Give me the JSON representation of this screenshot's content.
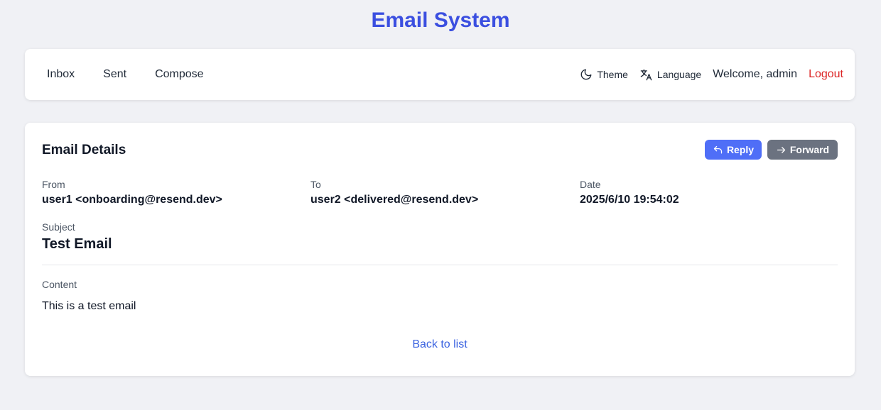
{
  "app": {
    "title": "Email System"
  },
  "nav": {
    "links": [
      "Inbox",
      "Sent",
      "Compose"
    ],
    "theme_label": "Theme",
    "language_label": "Language",
    "welcome": "Welcome, admin",
    "logout": "Logout"
  },
  "email": {
    "heading": "Email Details",
    "reply_label": "Reply",
    "forward_label": "Forward",
    "from_label": "From",
    "from_value": "user1 <onboarding@resend.dev>",
    "to_label": "To",
    "to_value": "user2 <delivered@resend.dev>",
    "date_label": "Date",
    "date_value": "2025/6/10 19:54:02",
    "subject_label": "Subject",
    "subject_value": "Test Email",
    "content_label": "Content",
    "content_value": "This is a test email",
    "back_label": "Back to list"
  },
  "icons": {
    "theme": "moon-icon",
    "language": "translate-icon",
    "reply": "reply-arrow-icon",
    "forward": "forward-arrow-icon"
  },
  "colors": {
    "accent": "#3b4fe0",
    "reply_button": "#4f6ef7",
    "forward_button": "#6b7280",
    "logout": "#dc2626",
    "link": "#3b63e0",
    "background": "#f0f1f5"
  }
}
